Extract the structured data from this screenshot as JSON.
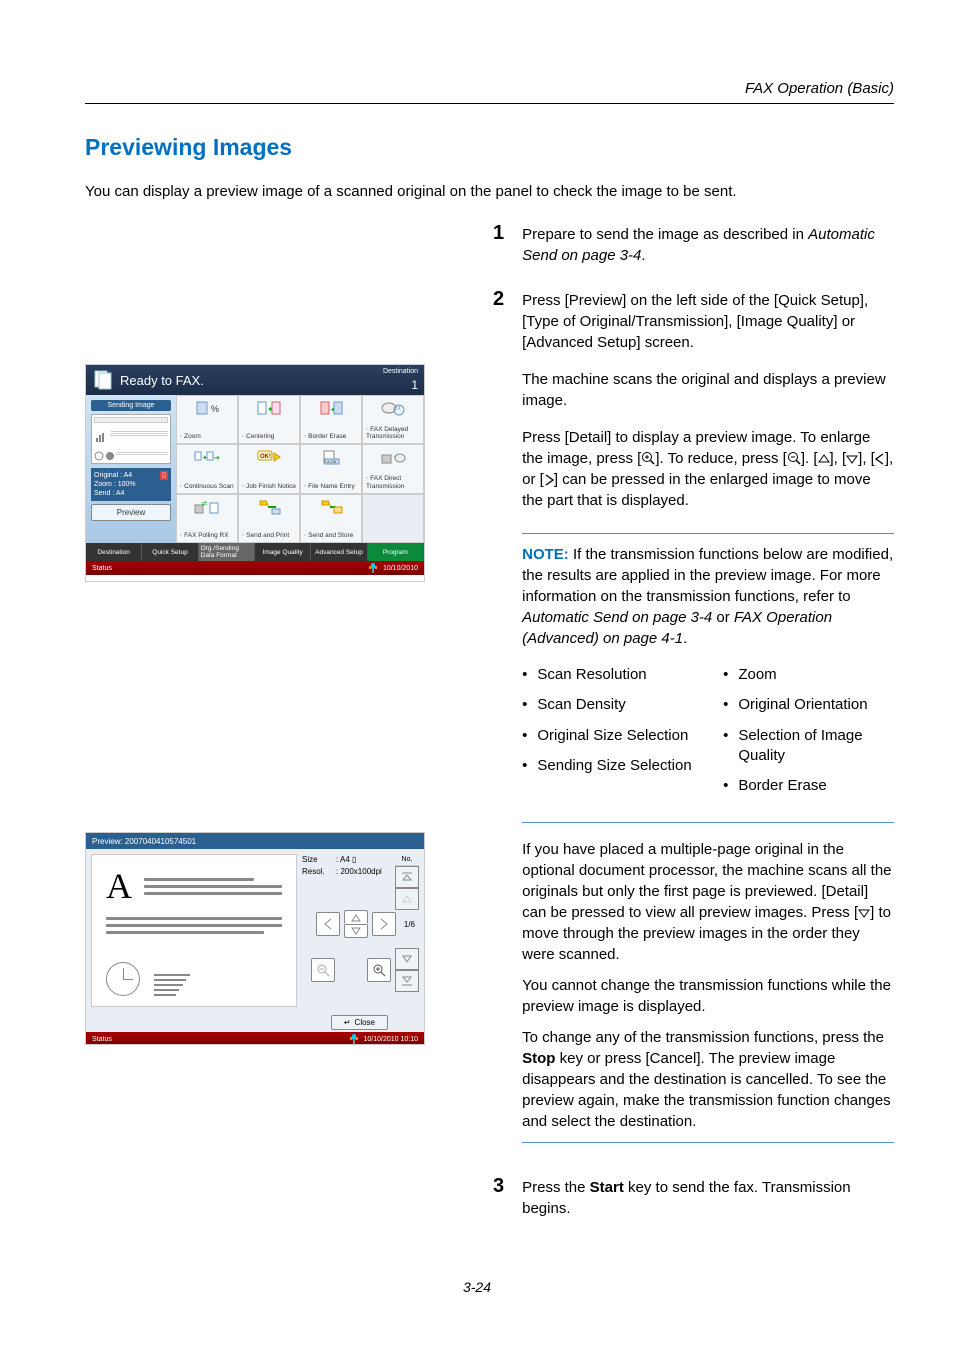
{
  "header": {
    "section": "FAX Operation (Basic)"
  },
  "title": "Previewing Images",
  "intro": "You can display a preview image of a scanned original on the panel to check the image to be sent.",
  "steps": {
    "s1": {
      "num": "1",
      "body": "Prepare to send the image as described in ",
      "em": "Automatic Send on page 3-4",
      "tail": "."
    },
    "s2": {
      "num": "2",
      "body": "Press [Preview] on the left side of the [Quick Setup], [Type of Original/Transmission], [Image Quality] or [Advanced Setup] screen.",
      "p2": "The machine scans the original and displays a preview image.",
      "p3a": "Press [Detail] to display a preview image. To enlarge the image, press [",
      "p3b": "]. To reduce, press [",
      "p3c": "]. [",
      "p3d": "], [",
      "p3e": "], [",
      "p3f": "], or [",
      "p3g": "] can be pressed in the enlarged image to move the part that is displayed."
    },
    "s3": {
      "num": "3",
      "body": "Press the ",
      "bold": "Start",
      "tail": " key to send the fax. Transmission begins."
    }
  },
  "note": {
    "label": "NOTE:",
    "body": " If the transmission functions below are modified, the results are applied in the preview image. For more information on the transmission functions, refer to ",
    "em1": "Automatic Send on page 3-4",
    "mid": " or ",
    "em2": "FAX Operation (Advanced) on page 4-1",
    "tail": "."
  },
  "bullets": {
    "left": [
      "Scan Resolution",
      "Scan Density",
      "Original Size Selection",
      "Sending Size Selection"
    ],
    "right": [
      "Zoom",
      "Original Orientation",
      "Selection of Image Quality",
      "Border Erase"
    ]
  },
  "multi": {
    "p1": "If you have placed a multiple-page original in the optional document processor, the machine scans all the originals but only the first page is previewed. [Detail] can be pressed to view all preview images. Press [",
    "p1b": "] to move through the preview images in the order they were scanned.",
    "p2": "You cannot change the transmission functions while the preview image is displayed.",
    "p3a": "To change any of the transmission functions, press the ",
    "p3bold": "Stop",
    "p3b": " key or press [Cancel]. The preview image disappears and the destination is cancelled. To see the preview again, make the transmission function changes and select the destination."
  },
  "scr1": {
    "title": "Ready to FAX.",
    "dest": "Destination",
    "dest_num": "1",
    "side_title": "Sending Image",
    "meta_original": "Original",
    "meta_original_v": ": A4",
    "meta_zoom": "Zoom",
    "meta_zoom_v": ": 100%",
    "meta_send": "Send",
    "meta_send_v": ": A4",
    "preview": "Preview",
    "cells": [
      "Zoom",
      "Centering",
      "Border Erase",
      "FAX Delayed Transmission",
      "Continuous Scan",
      "Job Finish Notice",
      "File Name Entry",
      "FAX Direct Transmission",
      "FAX Polling RX",
      "Send and Print",
      "Send and Store",
      ""
    ],
    "tabs": [
      "Destination",
      "Quick Setup",
      "Org./Sending Data Format",
      "Image Quality",
      "Advanced Setup",
      "Program"
    ],
    "status": "Status",
    "date": "10/10/2010"
  },
  "scr2": {
    "title": "Preview: 2007040410574501",
    "size_k": "Size",
    "size_v": ": A4",
    "resol_k": "Resol.",
    "resol_v": ": 200x100dpi",
    "no": "No.",
    "page": "1/6",
    "close": "Close",
    "status": "Status",
    "date": "10/10/2010  10:10",
    "big_a": "A"
  },
  "footer": "3-24"
}
